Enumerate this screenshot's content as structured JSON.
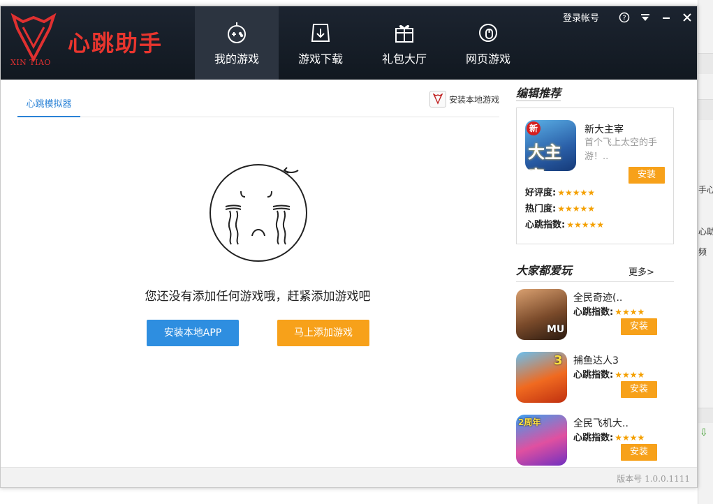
{
  "app": {
    "brand": "心跳助手",
    "brand_sub": "XIN TIAO",
    "nav": [
      {
        "label": "我的游戏",
        "icon": "gamepad-icon",
        "active": true
      },
      {
        "label": "游戏下载",
        "icon": "download-icon",
        "active": false
      },
      {
        "label": "礼包大厅",
        "icon": "gift-icon",
        "active": false
      },
      {
        "label": "网页游戏",
        "icon": "web-game-icon",
        "active": false
      }
    ],
    "login_label": "登录帐号",
    "colors": {
      "header_bg": "#151c26",
      "brand_red": "#e8352e",
      "accent_blue": "#2e8ee0",
      "accent_orange": "#f7a11a",
      "star": "#f4a000"
    }
  },
  "main": {
    "tab_label": "心跳模拟器",
    "install_local_label": "安装本地游戏",
    "empty_message": "您还没有添加任何游戏哦，赶紧添加游戏吧",
    "btn_install_app": "安装本地APP",
    "btn_add_game": "马上添加游戏"
  },
  "side": {
    "editor_title": "编辑推荐",
    "featured": {
      "icon_badge": "新",
      "icon_title": "大主宰",
      "name": "新大主宰",
      "desc": "首个飞上太空的手游！..",
      "install": "安装",
      "stats": [
        {
          "label": "好评度:",
          "stars": "★★★★★"
        },
        {
          "label": "热门度:",
          "stars": "★★★★★"
        },
        {
          "label": "心跳指数:",
          "stars": "★★★★★"
        }
      ]
    },
    "popular_title": "大家都爱玩",
    "more_label": "更多>",
    "games": [
      {
        "name": "全民奇迹(..",
        "stat_label": "心跳指数:",
        "stars": "★★★★",
        "install": "安装",
        "icon_text": "MU"
      },
      {
        "name": "捕鱼达人3",
        "stat_label": "心跳指数:",
        "stars": "★★★★",
        "install": "安装",
        "icon_text": "3"
      },
      {
        "name": "全民飞机大..",
        "stat_label": "心跳指数:",
        "stars": "★★★★",
        "install": "安装",
        "icon_text": "2周年"
      }
    ]
  },
  "footer": {
    "version": "版本号 1.0.0.1111"
  },
  "background_app": {
    "fragments": [
      "手心网",
      "心助手",
      "频"
    ]
  }
}
